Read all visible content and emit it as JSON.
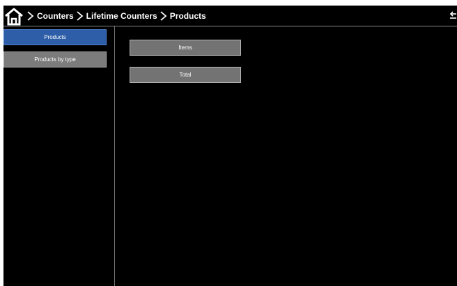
{
  "header": {
    "home_icon": "home-icon",
    "breadcrumb": [
      "Counters",
      "Lifetime Counters",
      "Products"
    ],
    "separator_icon": "chevron-right-icon",
    "back_icon": "back-arrow-icon"
  },
  "sidebar": {
    "items": [
      {
        "label": "Products",
        "active": true
      },
      {
        "label": "Products by type",
        "active": false
      }
    ]
  },
  "main": {
    "buttons": [
      {
        "label": "Items"
      },
      {
        "label": "Total"
      }
    ]
  },
  "colors": {
    "background": "#000000",
    "active_accent": "#2e5ea8",
    "inactive_button": "#7c7c7c",
    "content_button": "#737373",
    "text": "#ffffff"
  }
}
